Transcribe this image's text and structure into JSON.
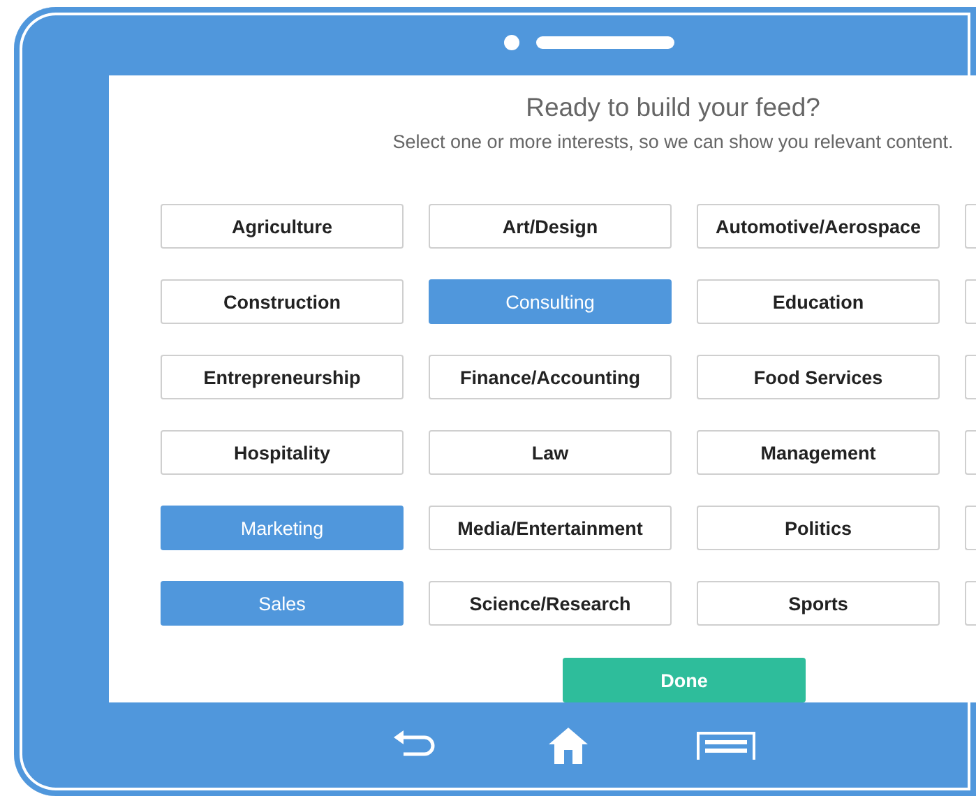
{
  "heading": {
    "title": "Ready to build your feed?",
    "subtitle": "Select one or more interests, so we can show you relevant content."
  },
  "interests": [
    {
      "label": "Agriculture",
      "selected": false
    },
    {
      "label": "Art/Design",
      "selected": false
    },
    {
      "label": "Automotive/Aerospace",
      "selected": false
    },
    {
      "selected": false
    },
    {
      "label": "Construction",
      "selected": false
    },
    {
      "label": "Consulting",
      "selected": true
    },
    {
      "label": "Education",
      "selected": false
    },
    {
      "selected": false
    },
    {
      "label": "Entrepreneurship",
      "selected": false
    },
    {
      "label": "Finance/Accounting",
      "selected": false
    },
    {
      "label": "Food Services",
      "selected": false
    },
    {
      "selected": false
    },
    {
      "label": "Hospitality",
      "selected": false
    },
    {
      "label": "Law",
      "selected": false
    },
    {
      "label": "Management",
      "selected": false
    },
    {
      "selected": false
    },
    {
      "label": "Marketing",
      "selected": true
    },
    {
      "label": "Media/Entertainment",
      "selected": false
    },
    {
      "label": "Politics",
      "selected": false
    },
    {
      "selected": false
    },
    {
      "label": "Sales",
      "selected": true
    },
    {
      "label": "Science/Research",
      "selected": false
    },
    {
      "label": "Sports",
      "selected": false
    },
    {
      "selected": false
    }
  ],
  "done_button": "Done"
}
